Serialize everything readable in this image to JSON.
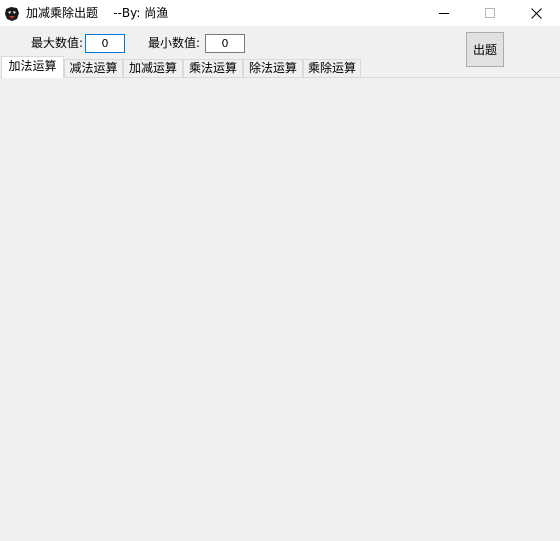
{
  "window": {
    "title": "加减乘除出题    --By: 尚渔",
    "icon": "app-logo-icon"
  },
  "controls": {
    "minimize_icon": "minimize-icon",
    "maximize_icon": "maximize-icon",
    "close_icon": "close-icon"
  },
  "form": {
    "max_label": "最大数值:",
    "max_value": "0",
    "min_label": "最小数值:",
    "min_value": "0",
    "generate_button": "出题"
  },
  "tabs": [
    {
      "label": "加法运算",
      "active": true
    },
    {
      "label": "减法运算",
      "active": false
    },
    {
      "label": "加减运算",
      "active": false
    },
    {
      "label": "乘法运算",
      "active": false
    },
    {
      "label": "除法运算",
      "active": false
    },
    {
      "label": "乘除运算",
      "active": false
    }
  ],
  "colors": {
    "window_bg": "#f0f0f0",
    "titlebar_bg": "#ffffff",
    "focus_border": "#0078d7"
  }
}
